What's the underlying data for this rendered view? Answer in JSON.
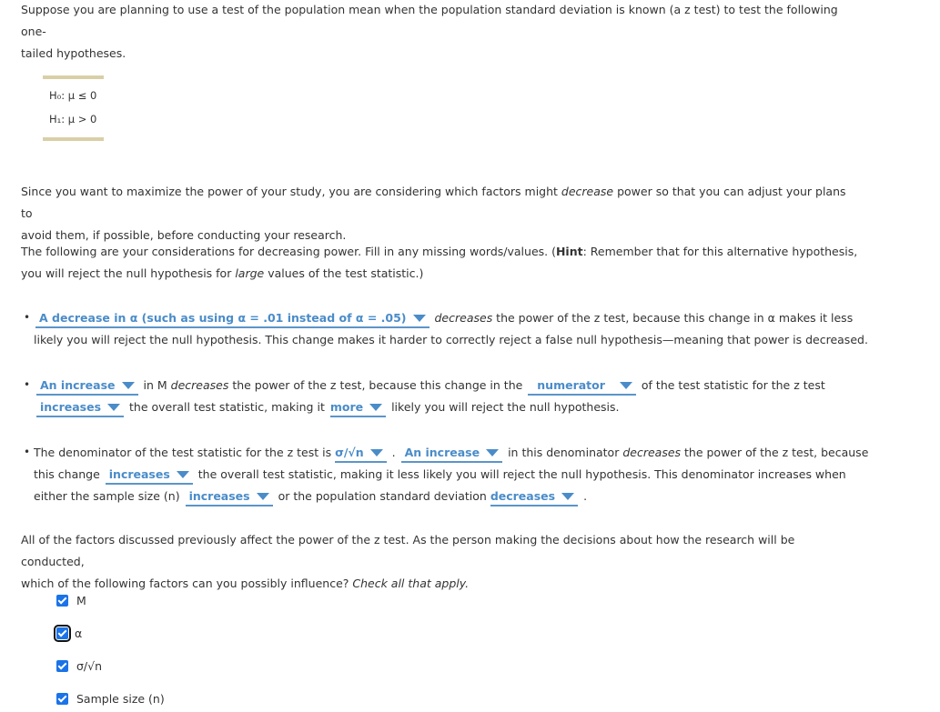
{
  "intro": {
    "line1": "Suppose you are planning to use a test of the population mean when the population standard deviation is known (a z test) to test the following one-",
    "line2": "tailed hypotheses."
  },
  "hypotheses": {
    "null": "H₀: μ ≤ 0",
    "alt": "H₁: μ > 0"
  },
  "para2": {
    "a": "Since you want to maximize the power of your study, you are considering which factors might ",
    "em": "decrease",
    "b": " power so that you can adjust your plans to",
    "line2": "avoid them, if possible, before conducting your research."
  },
  "para3": {
    "a": "The following are your considerations for decreasing power. Fill in any missing words/values. (",
    "hint": "Hint",
    "b": ": Remember that for this alternative hypothesis,",
    "c": "you will reject the null hypothesis for ",
    "em": "large",
    "d": " values of the test statistic.)"
  },
  "bullet1": {
    "dropdown1": "A decrease in α (such as using α = .01 instead of α = .05)",
    "em": "decreases",
    "a": " the power of the z test, because this change in α makes it less",
    "line2": "likely you will reject the null hypothesis. This change makes it harder to correctly reject a false null hypothesis—meaning that power is decreased."
  },
  "bullet2": {
    "dropdown1": "An increase",
    "a": " in M ",
    "em": "decreases",
    "b": " the power of the z test, because this change in the ",
    "dropdown2": "numerator",
    "c": " of the test statistic for the z test",
    "dropdown3": "increases",
    "d": " the overall test statistic, making it ",
    "dropdown4": "more",
    "e": " likely you will reject the null hypothesis."
  },
  "bullet3": {
    "a": "The denominator of the test statistic for the z test is ",
    "dropdown1": "σ/√n",
    "b": " . ",
    "dropdown2": "An increase",
    "c": " in this denominator ",
    "em": "decreases",
    "d": " the power of the z test, because",
    "e": "this change ",
    "dropdown3": "increases",
    "f": " the overall test statistic, making it less likely you will reject the null hypothesis. This denominator increases when",
    "g": "either the sample size (n) ",
    "dropdown4": "increases",
    "h": " or the population standard deviation ",
    "dropdown5": "decreases",
    "i": " ."
  },
  "para4": {
    "line1": "All of the factors discussed previously affect the power of the z test. As the person making the decisions about how the research will be conducted,",
    "a": "which of the following factors can you possibly influence? ",
    "em": "Check all that apply."
  },
  "checkboxes": [
    {
      "label": "M",
      "checked": true
    },
    {
      "label": "α",
      "checked": true,
      "focused": true
    },
    {
      "label": "σ/√n",
      "checked": true
    },
    {
      "label": "Sample size (n)",
      "checked": true
    }
  ],
  "colors": {
    "dropdown_text": "#4a8cc9",
    "checkbox": "#1a73e8",
    "hypothesis_bar": "#d9cfa7"
  }
}
